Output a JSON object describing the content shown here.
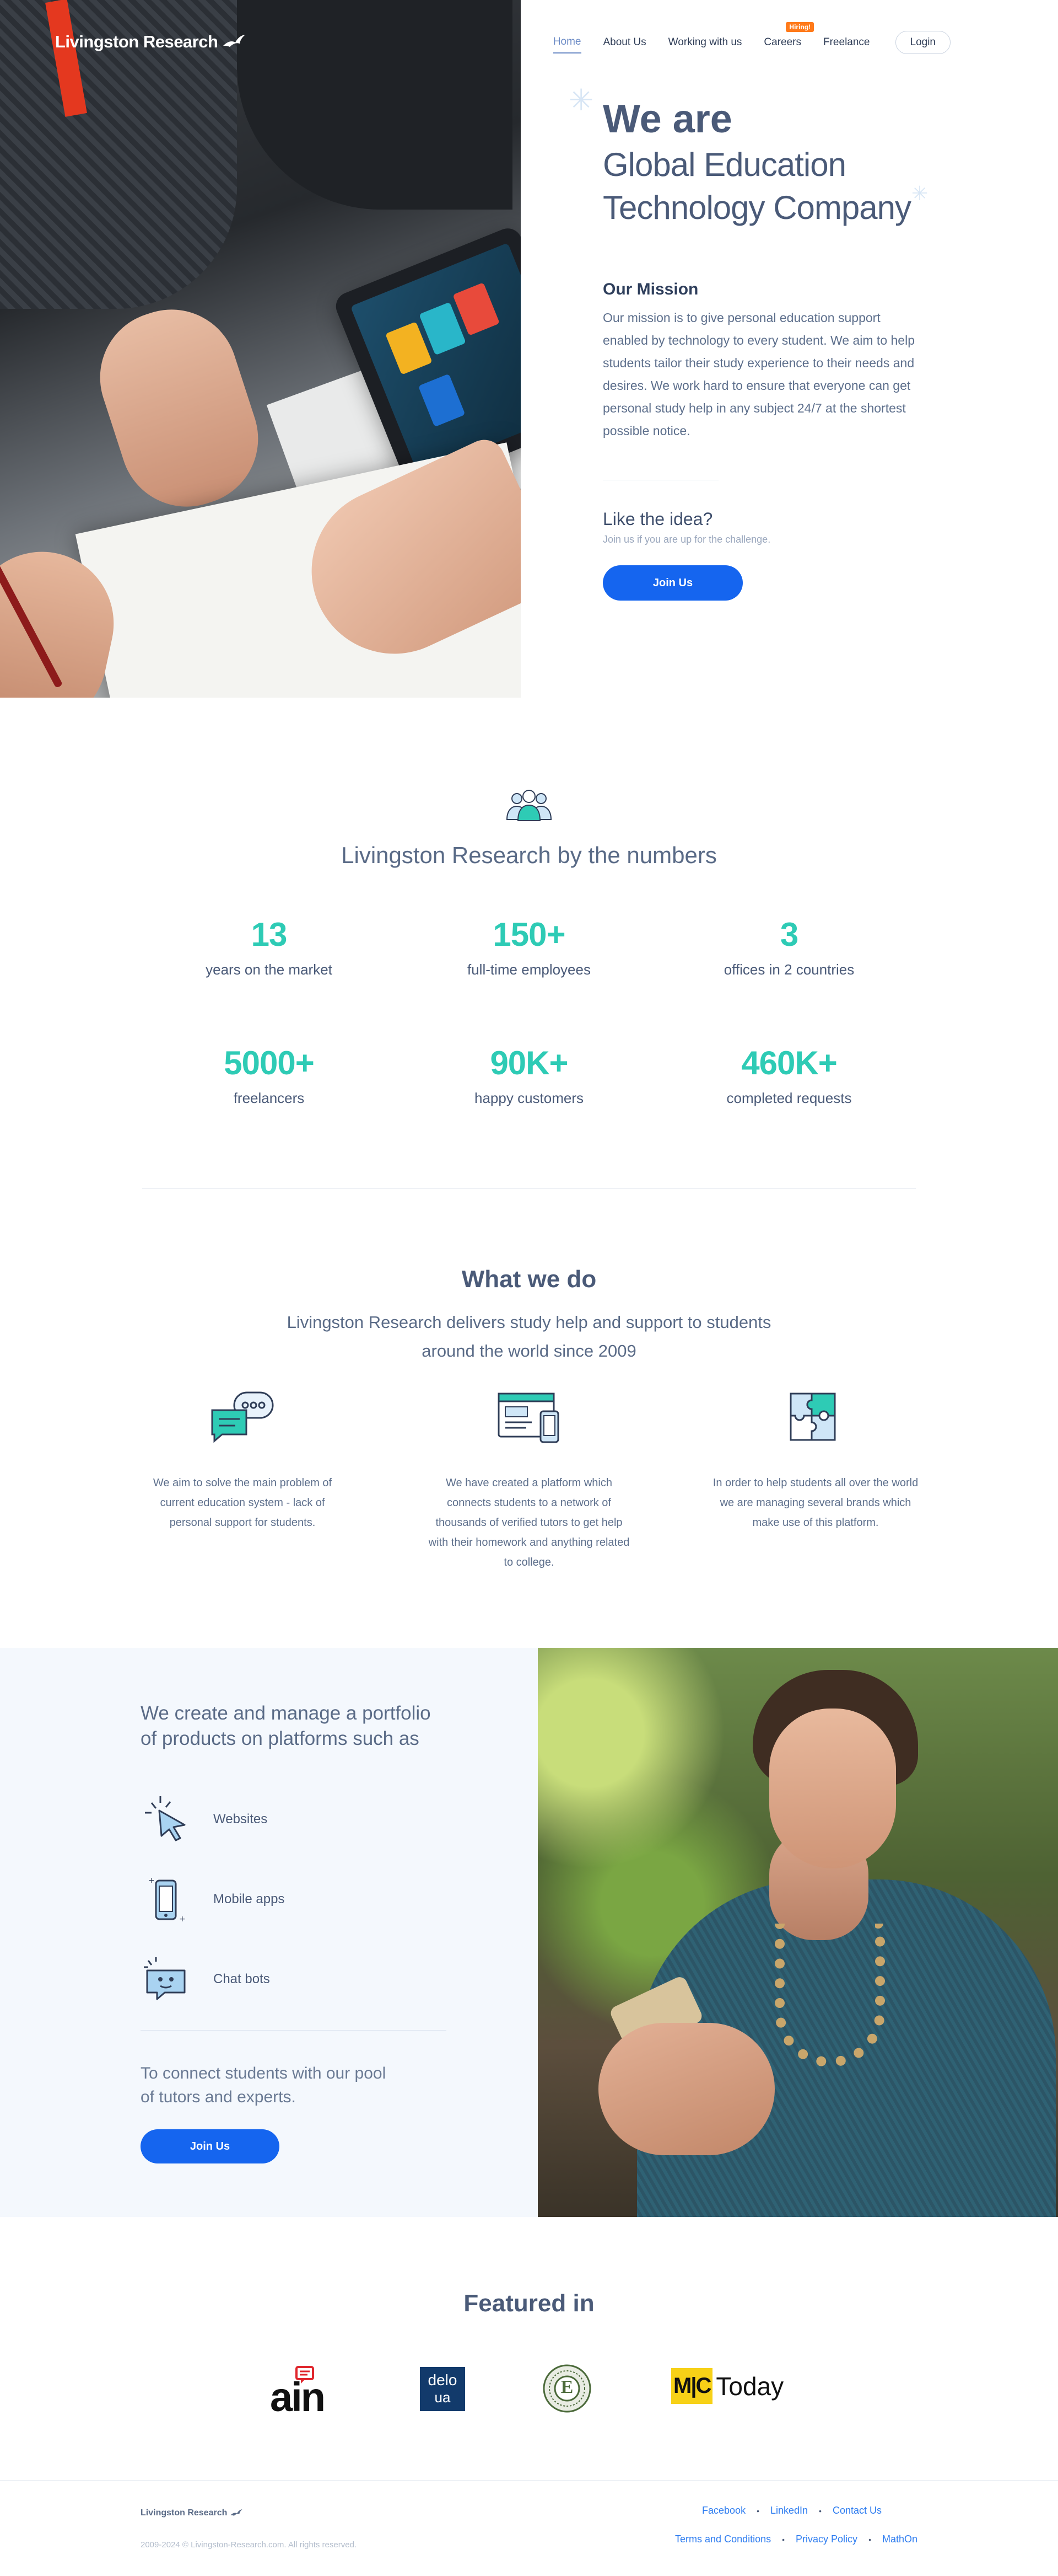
{
  "brand": {
    "name": "Livingston Research"
  },
  "nav": {
    "items": [
      "Home",
      "About Us",
      "Working with us",
      "Careers",
      "Freelance"
    ],
    "careers_badge": "Hiring!",
    "login": "Login"
  },
  "hero": {
    "we_are": "We are",
    "line1": "Global Education",
    "line2": "Technology Company",
    "mission_title": "Our Mission",
    "mission_text": "Our mission is to give personal education support enabled by technology to every student. We aim to help students tailor their study experience to their needs and desires. We work hard to ensure that everyone can get personal study help in any subject 24/7 at the shortest possible notice.",
    "idea_title": "Like the idea?",
    "idea_sub": "Join us if you are up for the challenge.",
    "join": "Join Us"
  },
  "numbers": {
    "title": "Livingston Research by the numbers",
    "stats": [
      {
        "value": "13",
        "label": "years on the market"
      },
      {
        "value": "150+",
        "label": "full-time employees"
      },
      {
        "value": "3",
        "label": "offices in 2 countries"
      },
      {
        "value": "5000+",
        "label": "freelancers"
      },
      {
        "value": "90K+",
        "label": "happy customers"
      },
      {
        "value": "460K+",
        "label": "completed requests"
      }
    ]
  },
  "what_we_do": {
    "title": "What we do",
    "subtitle_1": "Livingston Research delivers study help and support to students",
    "subtitle_2": "around the world since 2009",
    "columns": [
      {
        "icon": "chat-bubbles-icon",
        "text": "We aim to solve the main problem of current education system - lack of personal support for students."
      },
      {
        "icon": "platform-devices-icon",
        "text": "We have created a platform which connects students to a network of thousands of verified tutors to get help with their homework and anything related to college."
      },
      {
        "icon": "puzzle-icon",
        "text": "In order to help students all over the world we are managing several brands which make use of this platform."
      }
    ]
  },
  "portfolio": {
    "title_1": "We create and manage a portfolio",
    "title_2": "of products on platforms such as",
    "items": [
      {
        "icon": "cursor-click-icon",
        "label": "Websites"
      },
      {
        "icon": "smartphone-icon",
        "label": "Mobile apps"
      },
      {
        "icon": "chat-bot-icon",
        "label": "Chat bots"
      }
    ],
    "connect_1": "To connect students with our pool",
    "connect_2": "of tutors and experts.",
    "join": "Join Us"
  },
  "featured": {
    "title": "Featured in",
    "logos": {
      "ain": "ain",
      "delo_1": "delo",
      "delo_2": "ua",
      "badge": "E",
      "mc": "M|C",
      "today": "Today"
    }
  },
  "footer": {
    "logo": "Livingston Research",
    "copyright": "2009-2024 © Livingston-Research.com. All rights reserved.",
    "links_top": [
      "Facebook",
      "LinkedIn",
      "Contact Us"
    ],
    "links_bottom": [
      "Terms and Conditions",
      "Privacy Policy",
      "MathOn"
    ]
  },
  "colors": {
    "accent_blue": "#1565ef",
    "teal": "#2ecbb5",
    "heading": "#4a5a78",
    "badge_orange": "#ff7a1a"
  }
}
